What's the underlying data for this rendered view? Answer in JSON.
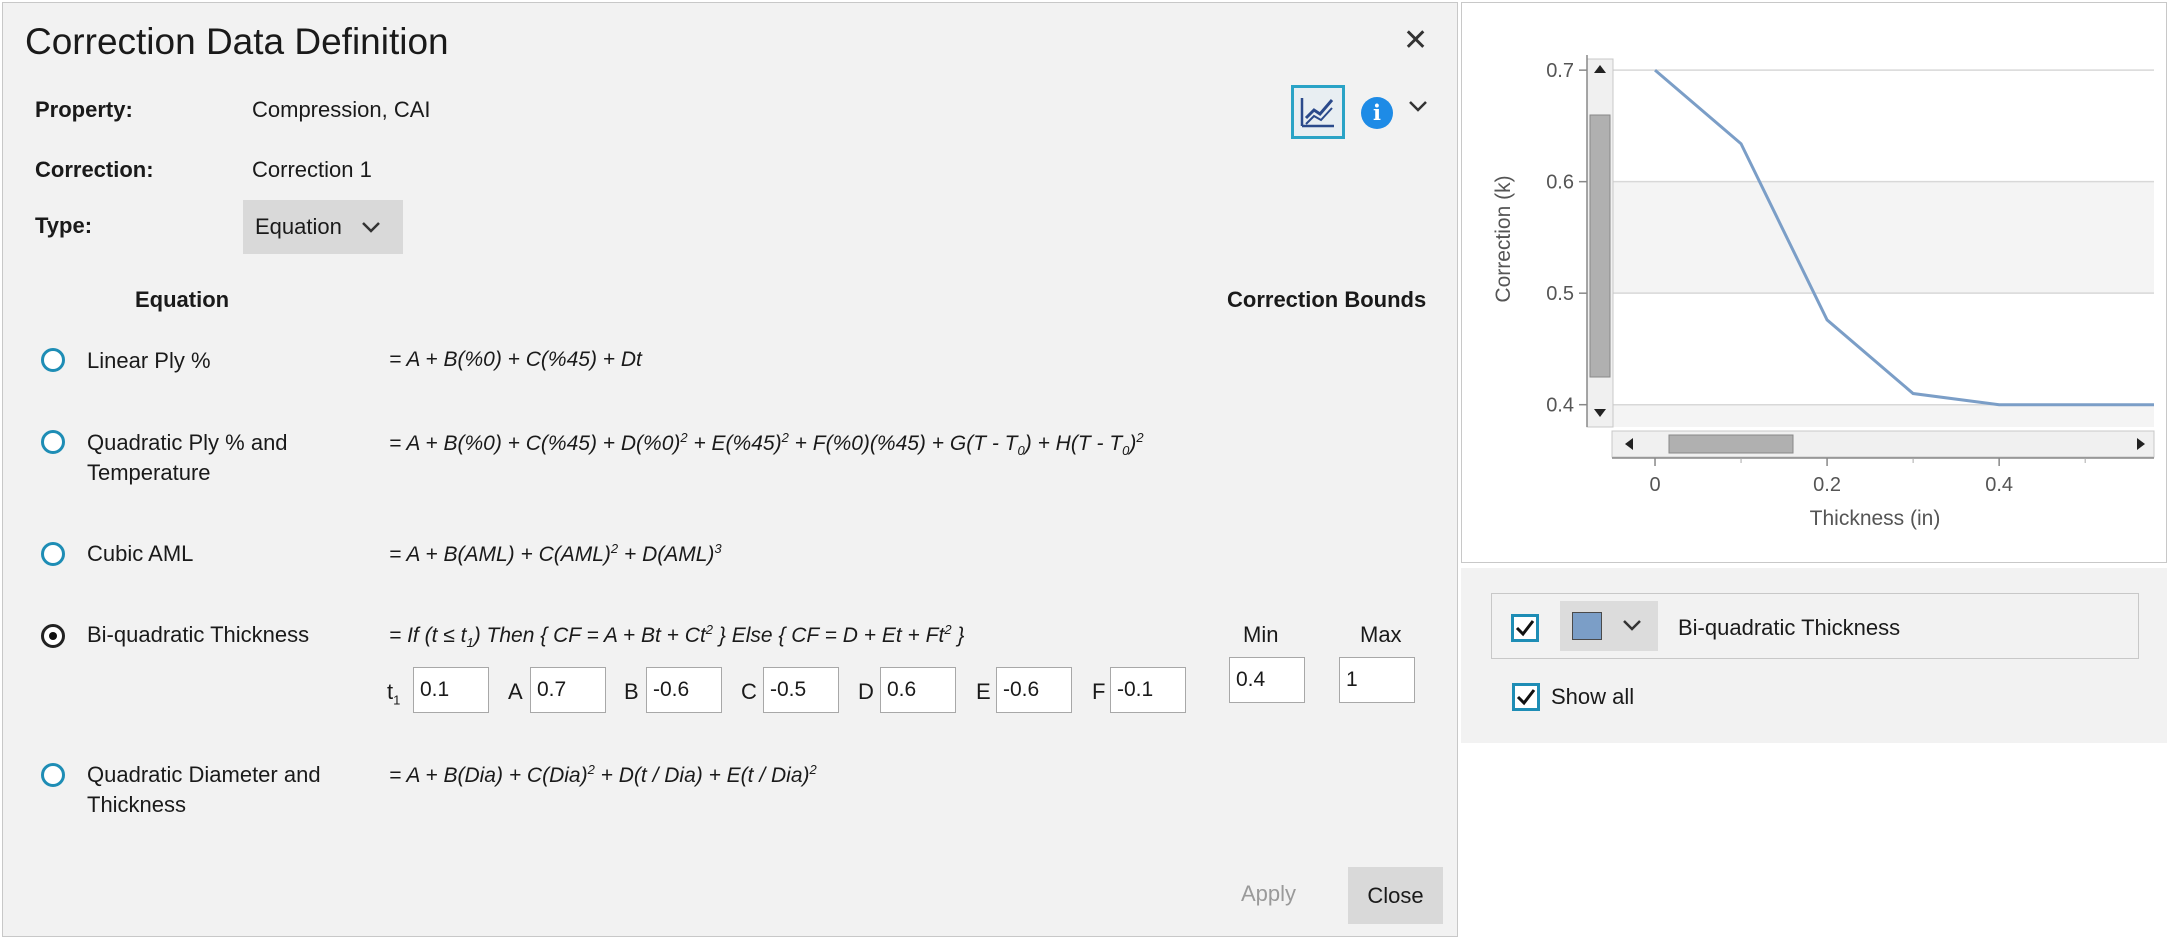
{
  "dialog": {
    "title": "Correction Data Definition",
    "close_icon": "close-icon",
    "property_label": "Property:",
    "property_value": "Compression, CAI",
    "correction_label": "Correction:",
    "correction_value": "Correction 1",
    "type_label": "Type:",
    "type_value": "Equation",
    "equation_header": "Equation",
    "bounds_header": "Correction Bounds",
    "options": [
      {
        "label": "Linear Ply %",
        "selected": false
      },
      {
        "label": "Quadratic Ply % and",
        "label2": "Temperature",
        "selected": false
      },
      {
        "label": "Cubic AML",
        "selected": false
      },
      {
        "label": "Bi-quadratic Thickness",
        "selected": true
      },
      {
        "label": "Quadratic Diameter and",
        "label2": "Thickness",
        "selected": false
      }
    ],
    "params": {
      "t1_label": "t",
      "t1_sub": "1",
      "t1": "0.1",
      "A_label": "A",
      "A": "0.7",
      "B_label": "B",
      "B": "-0.6",
      "C_label": "C",
      "C": "-0.5",
      "D_label": "D",
      "D": "0.6",
      "E_label": "E",
      "E": "-0.6",
      "F_label": "F",
      "F": "-0.1"
    },
    "bounds": {
      "min_label": "Min",
      "max_label": "Max",
      "min": "0.4",
      "max": "1"
    },
    "apply_label": "Apply",
    "close_label": "Close",
    "accent_color": "#1e8db5"
  },
  "chart_data": {
    "type": "line",
    "xlabel": "Thickness (in)",
    "ylabel": "Correction (k)",
    "x": [
      0,
      0.1,
      0.2,
      0.3,
      0.4,
      0.5,
      0.58
    ],
    "series": [
      {
        "name": "Bi-quadratic Thickness",
        "values": [
          0.7,
          0.634,
          0.476,
          0.41,
          0.4,
          0.4,
          0.4
        ],
        "color": "#7b9ec7"
      }
    ],
    "xlim": [
      -0.05,
      0.58
    ],
    "ylim": [
      0.38,
      0.71
    ],
    "xticks": [
      "0",
      "0.2",
      "0.4"
    ],
    "yticks": [
      "0.4",
      "0.5",
      "0.6",
      "0.7"
    ],
    "grid": true
  },
  "legend": {
    "series_label": "Bi-quadratic Thickness",
    "series_checked": true,
    "show_all_label": "Show all",
    "show_all_checked": true
  }
}
